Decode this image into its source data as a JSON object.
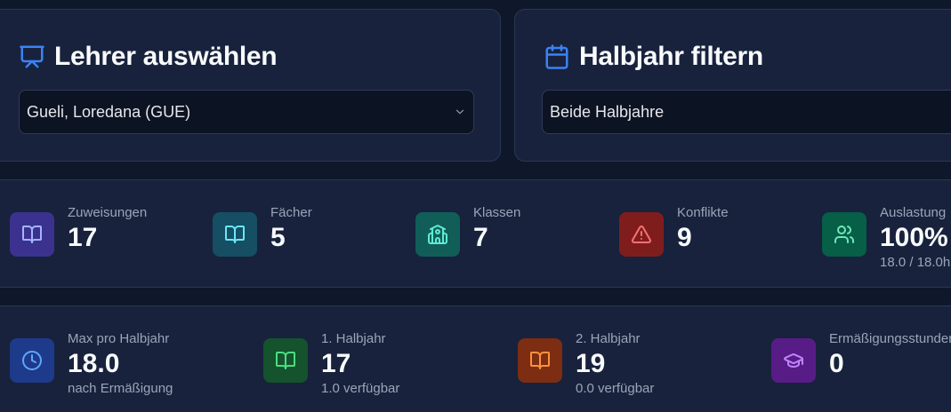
{
  "teacher_filter": {
    "title": "Lehrer auswählen",
    "selected": "Gueli, Loredana (GUE)"
  },
  "semester_filter": {
    "title": "Halbjahr filtern",
    "selected": "Beide Halbjahre"
  },
  "stats_row_1": [
    {
      "label": "Zuweisungen",
      "value": "17",
      "icon": "book-icon",
      "color": "#4c3fb0"
    },
    {
      "label": "Fächer",
      "value": "5",
      "icon": "book-open-icon",
      "color": "#1a5569"
    },
    {
      "label": "Klassen",
      "value": "7",
      "icon": "school-icon",
      "color": "#155c52"
    },
    {
      "label": "Konflikte",
      "value": "9",
      "icon": "warning-icon",
      "color": "#8f1f28"
    },
    {
      "label": "Auslastung",
      "value": "100%",
      "sub": "18.0 / 18.0h",
      "icon": "users-icon",
      "color": "#0f5c3c"
    }
  ],
  "stats_row_2": [
    {
      "label": "Max pro Halbjahr",
      "value": "18.0",
      "sub": "nach Ermäßigung",
      "icon": "clock-icon",
      "color": "#1e3a8a"
    },
    {
      "label": "1. Halbjahr",
      "value": "17",
      "sub": "1.0 verfügbar",
      "icon": "book-open-icon",
      "color": "#1d5b2d"
    },
    {
      "label": "2. Halbjahr",
      "value": "19",
      "sub": "0.0 verfügbar",
      "icon": "book-open-icon",
      "color": "#8a3214"
    },
    {
      "label": "Ermäßigungsstunden",
      "value": "0",
      "icon": "graduation-cap-icon",
      "color": "#5b21a6"
    }
  ]
}
